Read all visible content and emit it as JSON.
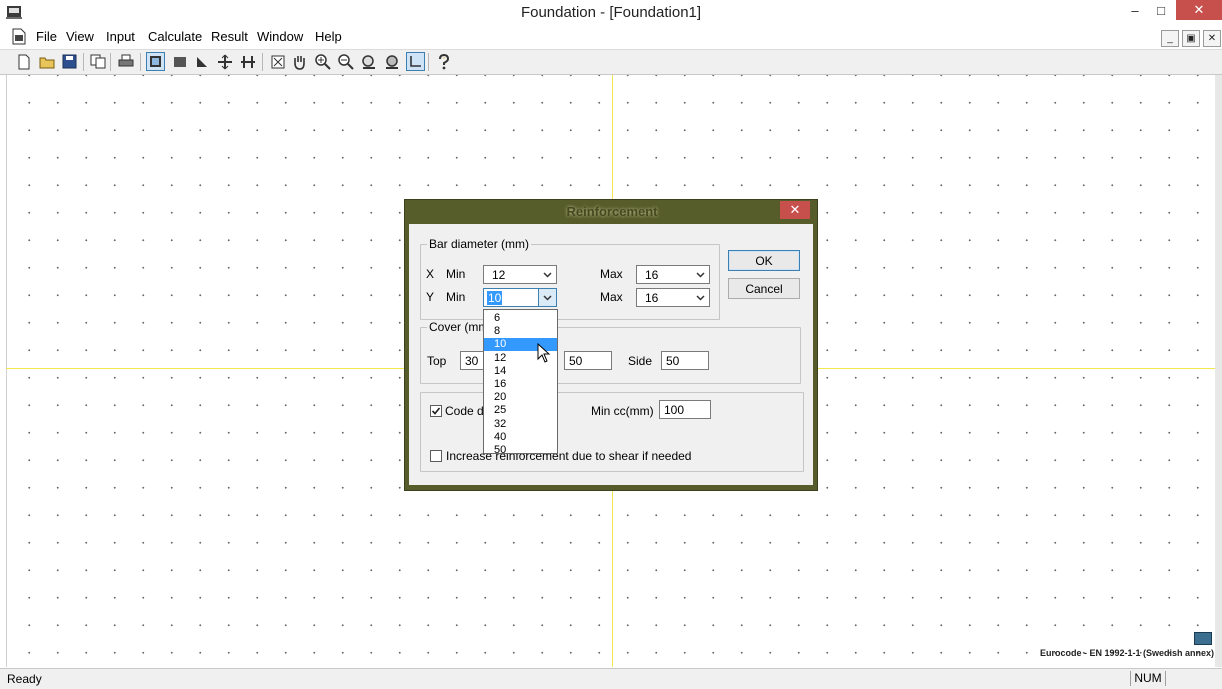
{
  "window": {
    "title": "Foundation - [Foundation1]",
    "min_glyph": "–",
    "max_glyph": "□",
    "close_glyph": "✕"
  },
  "menu": {
    "items": [
      "File",
      "View",
      "Input",
      "Calculate",
      "Result",
      "Window",
      "Help"
    ]
  },
  "mdi": {
    "min": "_",
    "restore": "▣",
    "close": "✕"
  },
  "dialog": {
    "title": "Reinforcement",
    "close_glyph": "✕",
    "bar_diameter": {
      "label": "Bar diameter (mm)",
      "x_label": "X",
      "y_label": "Y",
      "min_label": "Min",
      "max_label": "Max",
      "x_min": "12",
      "x_max": "16",
      "y_min": "10",
      "y_max": "16"
    },
    "cover": {
      "label": "Cover (mm)",
      "top_label": "Top",
      "top_value": "30",
      "bottom_value": "50",
      "side_label": "Side",
      "side_value": "50"
    },
    "code_checkbox_label": "Code de",
    "min_cc_label": "Min cc(mm)",
    "min_cc_value": "100",
    "shear_checkbox_label": "Increase reinforcement due to shear if needed",
    "ok_label": "OK",
    "cancel_label": "Cancel",
    "dropdown_options": [
      "6",
      "8",
      "10",
      "12",
      "14",
      "16",
      "20",
      "25",
      "32",
      "40",
      "50"
    ],
    "dropdown_selected": "10"
  },
  "footer": {
    "standard": "Eurocode - EN 1992-1-1 (Swedish annex)",
    "status": "Ready",
    "num": "NUM"
  }
}
